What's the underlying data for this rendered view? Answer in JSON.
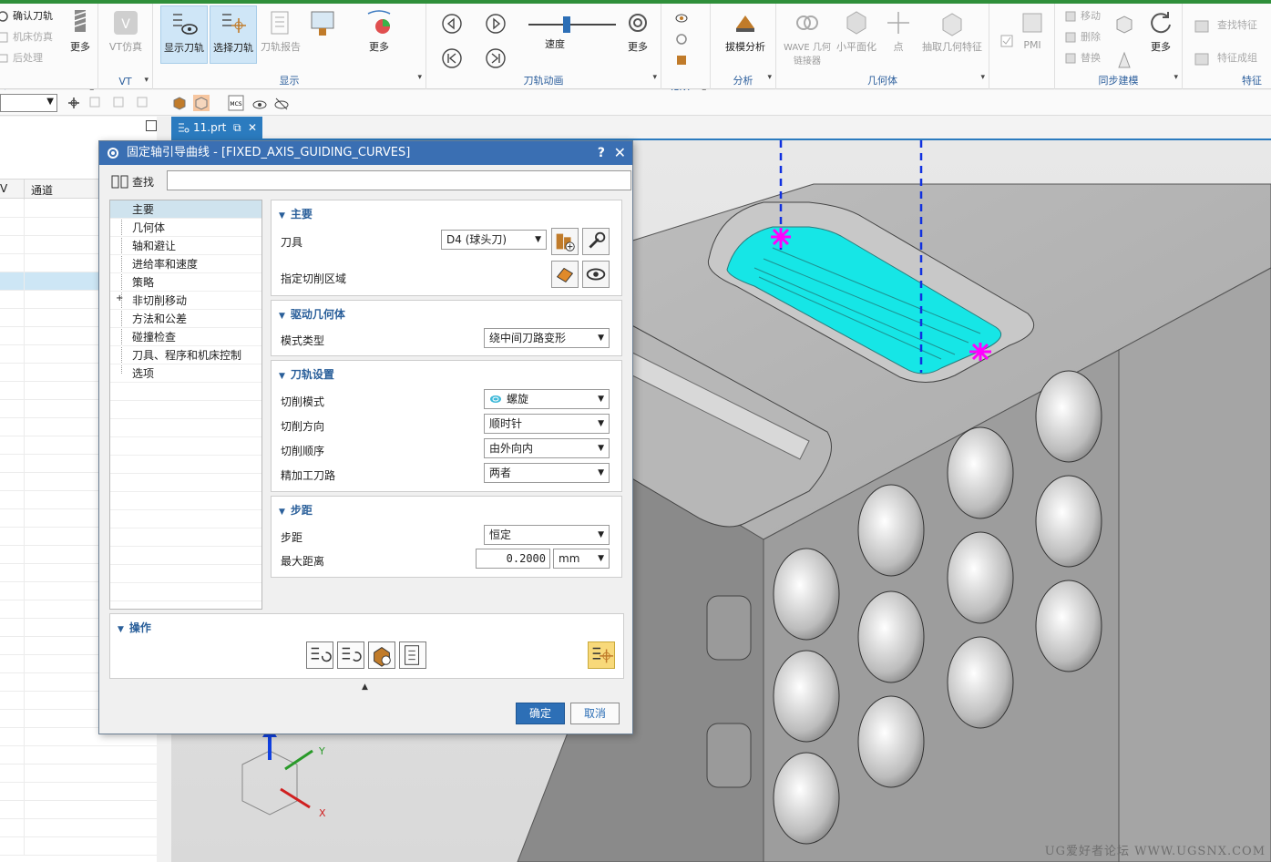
{
  "ribbon": {
    "groups": [
      {
        "label": "序"
      },
      {
        "label": "显示"
      },
      {
        "label": "刀轨动画"
      },
      {
        "label": "IPW"
      },
      {
        "label": "分析"
      },
      {
        "label": "几何体"
      },
      {
        "label": "同步建模"
      },
      {
        "label": "特征"
      }
    ],
    "left_items": [
      "确认刀轨",
      "机床仿真",
      "后处理"
    ],
    "more_label": "更多",
    "vt_label": "VT仿真",
    "vt_group": "VT",
    "display_buttons": [
      "显示刀轨",
      "选择刀轨",
      "刀轨报告"
    ],
    "speed_label": "速度",
    "draft_label": "拔模分析",
    "geom_buttons": [
      "WAVE 几何链接器",
      "小平面化",
      "点",
      "抽取几何特征"
    ],
    "pmi_label": "PMI",
    "sync_items": [
      "移动",
      "删除",
      "替换"
    ],
    "feature_items": [
      "查找特征",
      "特征成组"
    ]
  },
  "navigator": {
    "col1": "V",
    "col2": "通道"
  },
  "tab": {
    "file": "11.prt"
  },
  "dialog": {
    "title": "固定轴引导曲线 - [FIXED_AXIS_GUIDING_CURVES]",
    "help": "?",
    "find_label": "查找",
    "tree": [
      "主要",
      "几何体",
      "轴和避让",
      "进给率和速度",
      "策略",
      "非切削移动",
      "方法和公差",
      "碰撞检查",
      "刀具、程序和机床控制",
      "选项"
    ],
    "sections": {
      "main": {
        "title": "主要",
        "tool_label": "刀具",
        "tool_value": "D4 (球头刀)",
        "cut_area_label": "指定切削区域"
      },
      "drive": {
        "title": "驱动几何体",
        "mode_label": "模式类型",
        "mode_value": "绕中间刀路变形"
      },
      "path": {
        "title": "刀轨设置",
        "cut_pattern_label": "切削模式",
        "cut_pattern_value": "螺旋",
        "cut_dir_label": "切削方向",
        "cut_dir_value": "顺时针",
        "cut_order_label": "切削顺序",
        "cut_order_value": "由外向内",
        "finish_label": "精加工刀路",
        "finish_value": "两者"
      },
      "stepover": {
        "title": "步距",
        "step_label": "步距",
        "step_value": "恒定",
        "max_dist_label": "最大距离",
        "max_dist_value": "0.2000",
        "unit_value": "mm"
      }
    },
    "operations_title": "操作",
    "ok": "确定",
    "cancel": "取消"
  },
  "viewport": {
    "watermark": "UG爱好者论坛 WWW.UGSNX.COM",
    "axis_labels": {
      "x": "X",
      "y": "Y"
    }
  }
}
